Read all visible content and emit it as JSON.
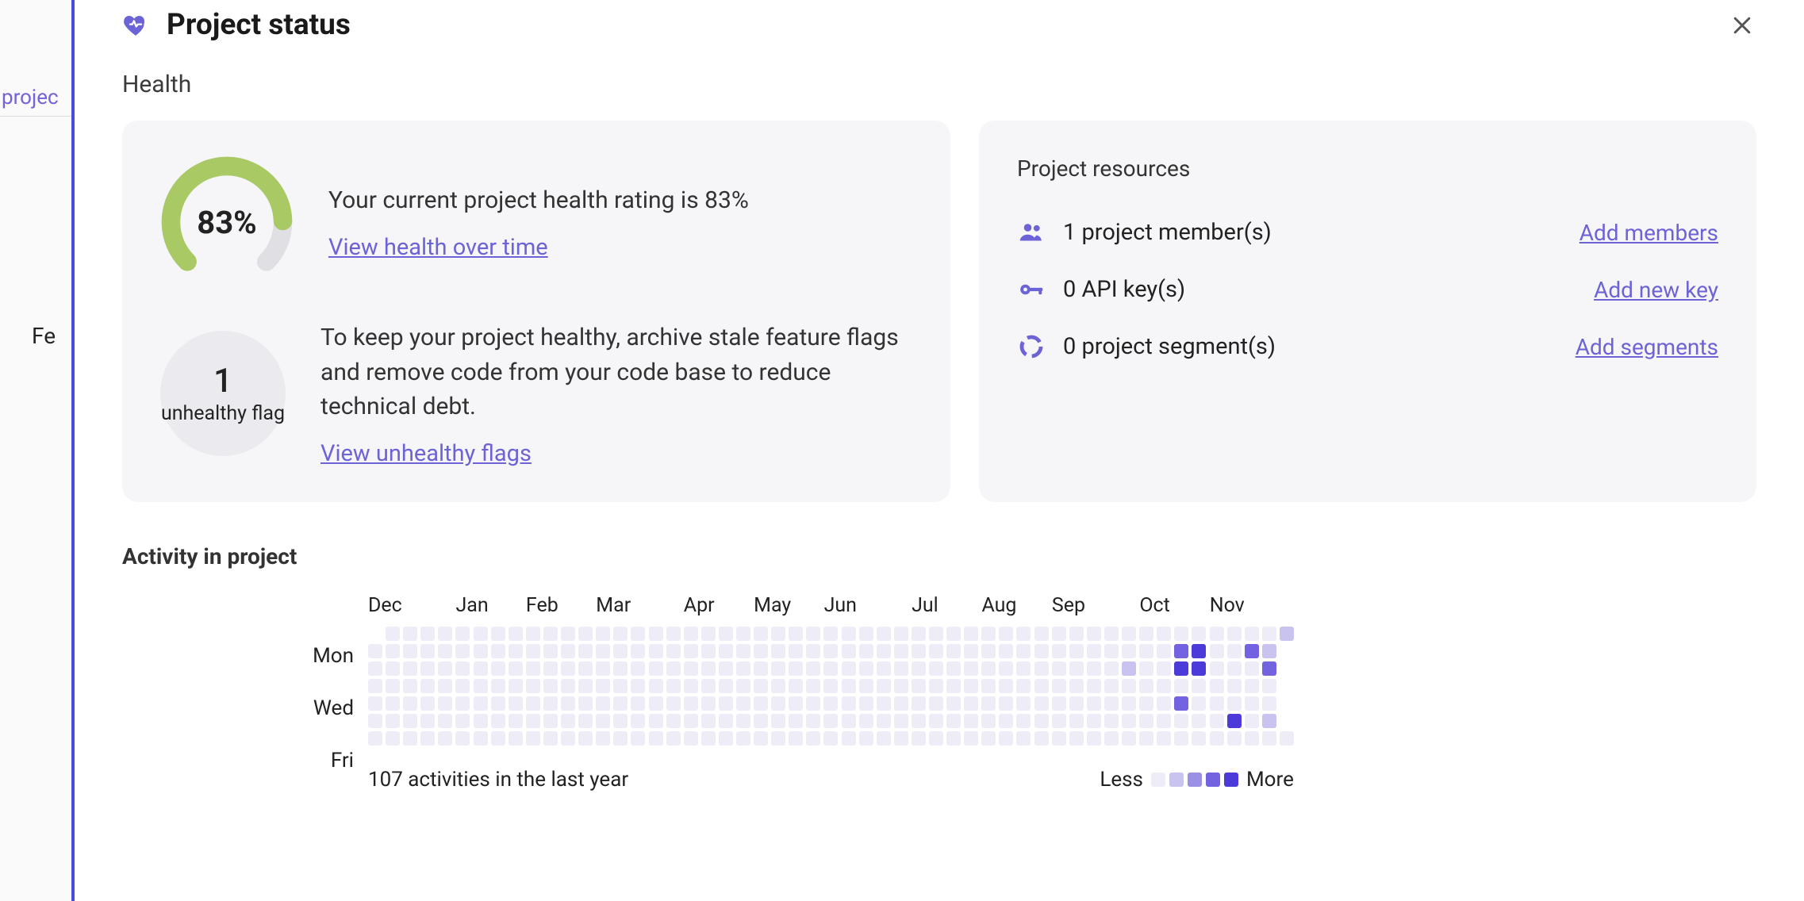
{
  "panel": {
    "title": "Project status"
  },
  "bg": {
    "projects_label": "projec",
    "feature_label": "Fe"
  },
  "health": {
    "section_title": "Health",
    "percent_label": "83%",
    "rating_text": "Your current project health rating is 83%",
    "view_health_link": "View health over time",
    "unhealthy_count": "1",
    "unhealthy_label": "unhealthy flag",
    "tip_text": "To keep your project healthy, archive stale feature flags and remove code from your code base to reduce technical debt.",
    "view_unhealthy_link": "View unhealthy flags"
  },
  "resources": {
    "title": "Project resources",
    "items": [
      {
        "label": "1 project member(s)",
        "link": "Add members"
      },
      {
        "label": "0 API key(s)",
        "link": "Add new key"
      },
      {
        "label": "0 project segment(s)",
        "link": "Add segments"
      }
    ]
  },
  "activity": {
    "title": "Activity in project",
    "day_labels": [
      "Mon",
      "Wed",
      "Fri"
    ],
    "months": [
      {
        "label": "Dec",
        "weeks": 5
      },
      {
        "label": "Jan",
        "weeks": 4
      },
      {
        "label": "Feb",
        "weeks": 4
      },
      {
        "label": "Mar",
        "weeks": 5
      },
      {
        "label": "Apr",
        "weeks": 4
      },
      {
        "label": "May",
        "weeks": 4
      },
      {
        "label": "Jun",
        "weeks": 5
      },
      {
        "label": "Jul",
        "weeks": 4
      },
      {
        "label": "Aug",
        "weeks": 4
      },
      {
        "label": "Sep",
        "weeks": 5
      },
      {
        "label": "Oct",
        "weeks": 4
      },
      {
        "label": "Nov",
        "weeks": 4
      }
    ],
    "footer_count": "107 activities in the last year",
    "legend_less": "Less",
    "legend_more": "More",
    "grid": [
      "E0000000000000000000000000000000000000000000000000001",
      "0000000000000000000000000000000000000000000000340031E",
      "0000000000000000000000000000000000000000000100440003E",
      "0000000000000000000000000000000000000000000000000000E",
      "0000000000000000000000000000000000000000000000300000E",
      "0000000000000000000000000000000000000000000000000401E",
      "00000000000000000000000000000000000000000000000000000"
    ]
  }
}
